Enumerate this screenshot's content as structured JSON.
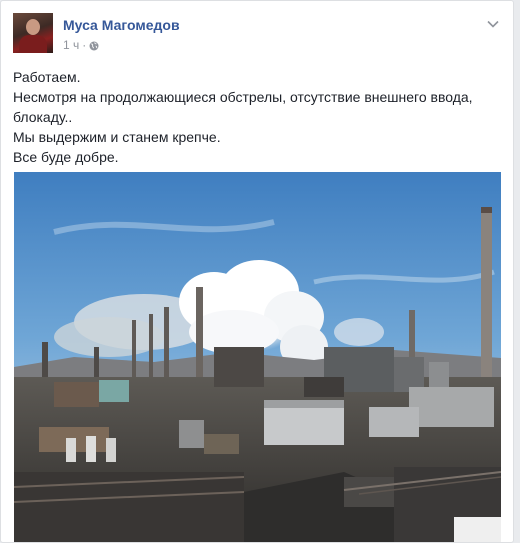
{
  "post": {
    "author_name": "Муса Магомедов",
    "timestamp": "1 ч",
    "separator": "·",
    "privacy_icon": "globe-icon",
    "menu_icon": "chevron-down-icon",
    "lines": [
      "Работаем.",
      "Несмотря на продолжающиеся обстрелы, отсутствие внешнего ввода, блокаду..",
      "Мы выдержим и станем крепче.",
      "Все буде добре."
    ]
  },
  "colors": {
    "author_link": "#365899",
    "meta_text": "#90949c",
    "body_text": "#1d2129",
    "card_border": "#dddfe2",
    "page_background": "#e9ebee"
  }
}
